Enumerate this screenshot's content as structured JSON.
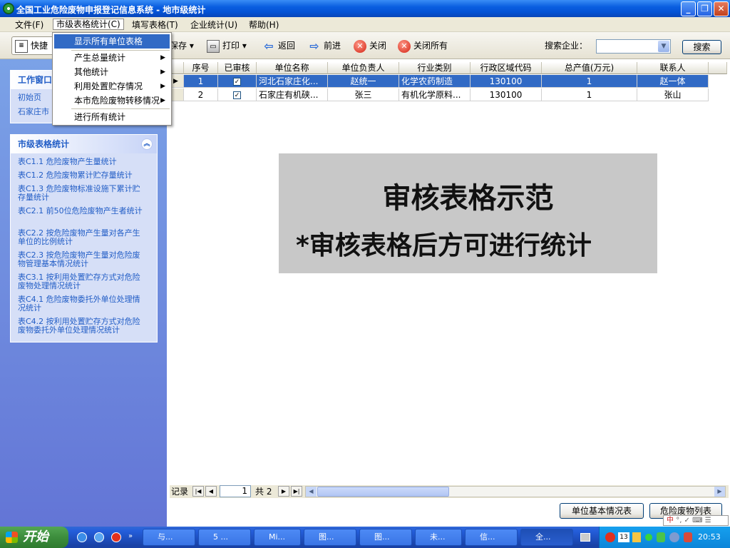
{
  "window": {
    "title": "全国工业危险废物申报登记信息系统 - 地市级统计"
  },
  "menu": {
    "items": [
      "文件(F)",
      "市级表格统计(C)",
      "填写表格(T)",
      "企业统计(U)",
      "帮助(H)"
    ]
  },
  "dropdown": {
    "items": [
      "显示所有单位表格",
      "产生总量统计",
      "其他统计",
      "利用处置贮存情况",
      "本市危险废物转移情况",
      "进行所有统计"
    ]
  },
  "toolbar": {
    "quick": "快捷",
    "save": "保存",
    "print": "打印",
    "back": "返回",
    "forward": "前进",
    "close": "关闭",
    "close_all": "关闭所有",
    "search_label": "搜索企业：",
    "search_value": "",
    "search_button": "搜索"
  },
  "sidebar": {
    "work_window": {
      "title": "工作窗口",
      "links": [
        "初始页",
        "石家庄市"
      ]
    },
    "city_stats": {
      "title": "市级表格统计",
      "links": [
        "表C1.1 危险废物产生量统计",
        "表C1.2 危险废物累计贮存量统计",
        "表C1.3 危险废物标准设施下累计贮存量统计",
        "表C2.1 前50位危险废物产生者统计",
        "表C2.2 按危险废物产生量对各产生单位的比例统计",
        "表C2.3 按危险废物产生量对危险废物管理基本情况统计",
        "表C3.1 按利用处置贮存方式对危险废物处理情况统计",
        "表C4.1 危险废物委托外单位处理情况统计",
        "表C4.2 按利用处置贮存方式对危险废物委托外单位处理情况统计"
      ]
    }
  },
  "table": {
    "columns": [
      "序号",
      "已审核",
      "单位名称",
      "单位负责人",
      "行业类别",
      "行政区域代码",
      "总产值(万元)",
      "联系人"
    ],
    "rows": [
      {
        "no": "1",
        "checked": true,
        "name": "河北石家庄化...",
        "leader": "赵统一",
        "industry": "化学农药制造",
        "code": "130100",
        "value": "1",
        "contact": "赵一体"
      },
      {
        "no": "2",
        "checked": true,
        "name": "石家庄有机硖...",
        "leader": "张三",
        "industry": "有机化学原料...",
        "code": "130100",
        "value": "1",
        "contact": "张山"
      }
    ]
  },
  "notice": {
    "line1": "审核表格示范",
    "line2": "*审核表格后方可进行统计"
  },
  "navigator": {
    "label": "记录",
    "current": "1",
    "total": "共 2"
  },
  "bottom_buttons": {
    "basic": "单位基本情况表",
    "waste_list": "危险废物列表"
  },
  "taskbar": {
    "start": "开始",
    "tasks": [
      "与...",
      "5 ...",
      "Mi...",
      "图...",
      "图...",
      "未...",
      "信...",
      "全..."
    ],
    "tray_badge": "13",
    "clock": "20:53"
  }
}
